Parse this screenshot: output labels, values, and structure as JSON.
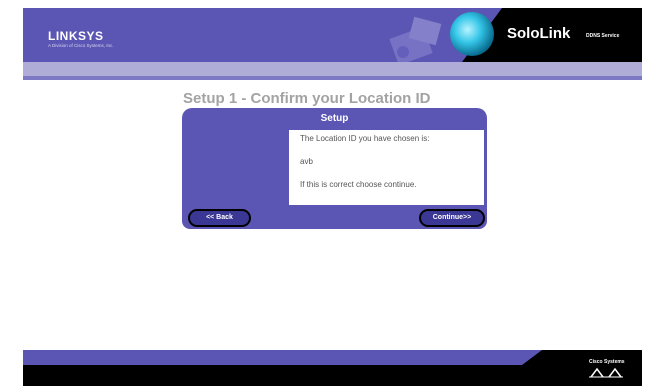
{
  "brand": {
    "logo": "LINKSYS",
    "logo_subtitle": "A Division of Cisco Systems, Inc.",
    "product": "SoloLink",
    "product_suffix": "DDNS Service"
  },
  "page": {
    "title": "Setup 1 - Confirm your Location ID",
    "panel_heading": "Setup",
    "line1": "The Location ID you have chosen is:",
    "location_id": "avb",
    "line3": "If this is correct choose continue."
  },
  "buttons": {
    "back": "<< Back",
    "continue": "Continue>>"
  },
  "footer": {
    "cisco": "Cisco Systems"
  },
  "colors": {
    "brand_purple": "#5b56b4",
    "light_purple": "#b0acd8",
    "title_gray": "#a3a3a3"
  }
}
